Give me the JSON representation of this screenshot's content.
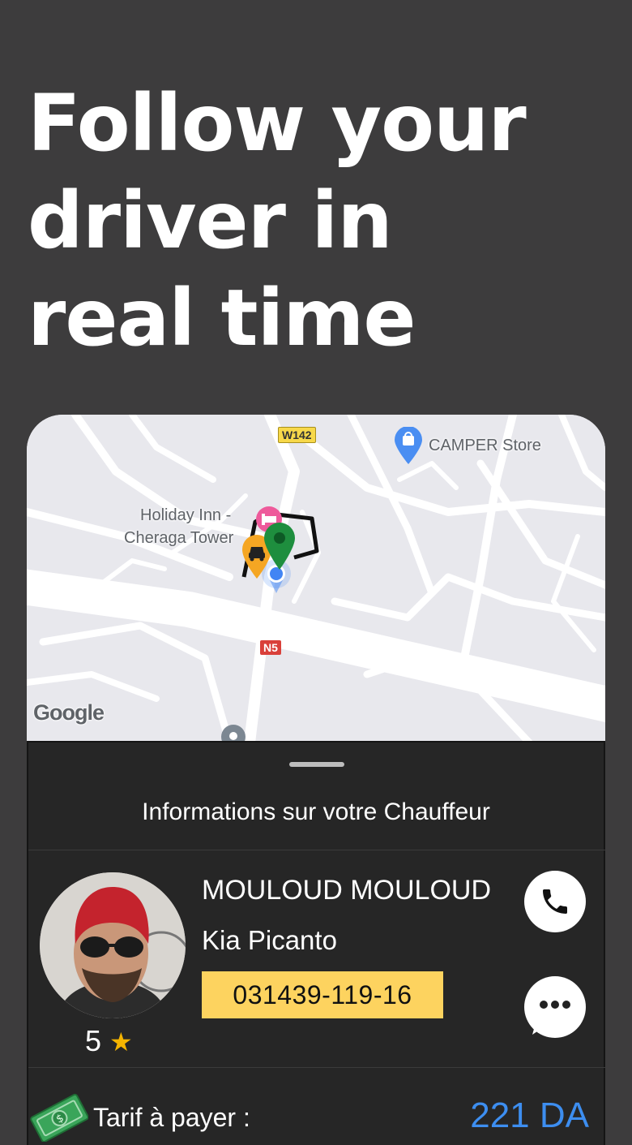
{
  "headline": {
    "line1": "Follow your",
    "line2": "driver in",
    "line3": "real time"
  },
  "map": {
    "labels": {
      "camper_store": "CAMPER Store",
      "holiday_inn_1": "Holiday Inn -",
      "holiday_inn_2": "Cheraga Tower",
      "road_w142": "W142",
      "road_n5": "N5",
      "google_logo": "Google"
    },
    "marker_colors": {
      "taxi": "#f5a623",
      "destination": "#1e8e3e",
      "current_location": "#4285f4",
      "hotel": "#ee5a9b"
    }
  },
  "sheet": {
    "title": "Informations sur votre Chauffeur",
    "driver": {
      "name": "MOULOUD MOULOUD",
      "car": "Kia Picanto",
      "plate": "031439-119-16",
      "rating": "5",
      "rating_icon": "star-icon"
    },
    "actions": {
      "call_icon": "phone-icon",
      "message_icon": "chat-bubble-icon"
    },
    "fare": {
      "label": "Tarif à payer :",
      "value": "221 DA",
      "icon": "money-icon"
    }
  },
  "colors": {
    "background": "#3d3c3d",
    "sheet": "#262626",
    "plate": "#fdd35f",
    "fare_value": "#3d8ef0"
  }
}
